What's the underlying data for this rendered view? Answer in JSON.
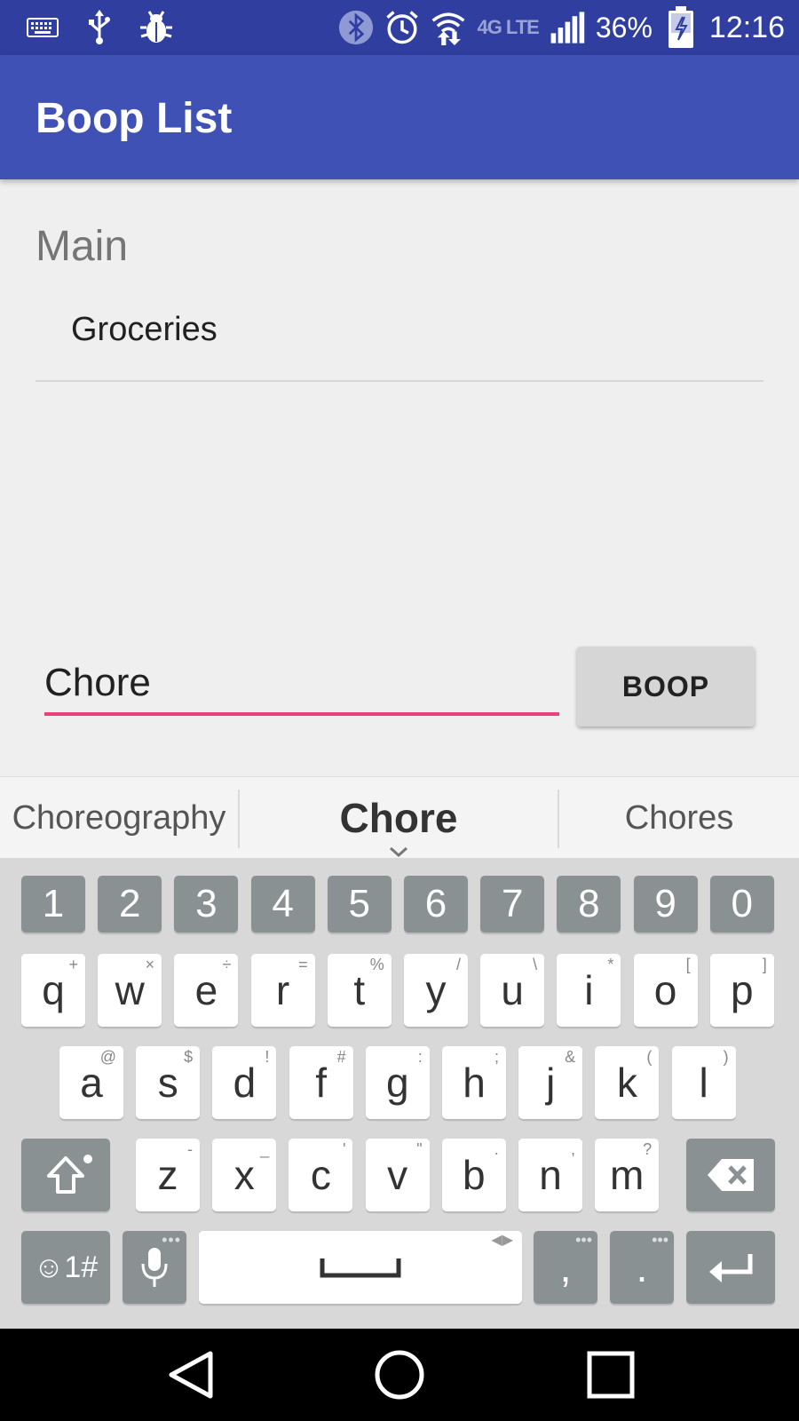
{
  "status_bar": {
    "battery_percent": "36%",
    "time": "12:16",
    "network_label": "4G LTE",
    "left_icons": [
      "keyboard-icon",
      "usb-icon",
      "bug-icon"
    ],
    "right_icons": [
      "bluetooth-icon",
      "alarm-icon",
      "wifi-icon",
      "signal-icon",
      "battery-charging-icon"
    ]
  },
  "app_bar": {
    "title": "Boop List"
  },
  "section": {
    "title": "Main",
    "items": [
      {
        "label": "Groceries"
      }
    ]
  },
  "input": {
    "value": "Chore"
  },
  "boop_button": {
    "label": "BOOP"
  },
  "suggestions": {
    "left": "Choreography",
    "center": "Chore",
    "right": "Chores"
  },
  "keyboard": {
    "numbers": [
      "1",
      "2",
      "3",
      "4",
      "5",
      "6",
      "7",
      "8",
      "9",
      "0"
    ],
    "row1": [
      {
        "k": "q",
        "alt": "+"
      },
      {
        "k": "w",
        "alt": "×"
      },
      {
        "k": "e",
        "alt": "÷"
      },
      {
        "k": "r",
        "alt": "="
      },
      {
        "k": "t",
        "alt": "%"
      },
      {
        "k": "y",
        "alt": "/"
      },
      {
        "k": "u",
        "alt": "\\"
      },
      {
        "k": "i",
        "alt": "*"
      },
      {
        "k": "o",
        "alt": "["
      },
      {
        "k": "p",
        "alt": "]"
      }
    ],
    "row2": [
      {
        "k": "a",
        "alt": "@"
      },
      {
        "k": "s",
        "alt": "$"
      },
      {
        "k": "d",
        "alt": "!"
      },
      {
        "k": "f",
        "alt": "#"
      },
      {
        "k": "g",
        "alt": ":"
      },
      {
        "k": "h",
        "alt": ";"
      },
      {
        "k": "j",
        "alt": "&"
      },
      {
        "k": "k",
        "alt": "("
      },
      {
        "k": "l",
        "alt": ")"
      }
    ],
    "row3": [
      {
        "k": "z",
        "alt": "-"
      },
      {
        "k": "x",
        "alt": "_"
      },
      {
        "k": "c",
        "alt": "'"
      },
      {
        "k": "v",
        "alt": "\""
      },
      {
        "k": "b",
        "alt": "."
      },
      {
        "k": "n",
        "alt": ","
      },
      {
        "k": "m",
        "alt": "?"
      }
    ],
    "symbols_label": "☺1#",
    "comma_label": ",",
    "period_label": ".",
    "icons": [
      "shift-icon",
      "backspace-icon",
      "mic-icon",
      "space-icon",
      "enter-icon"
    ]
  },
  "nav_bar": {
    "icons": [
      "back-icon",
      "home-icon",
      "recents-icon"
    ]
  },
  "colors": {
    "status_bar": "#303f9f",
    "app_bar": "#3f51b5",
    "accent": "#ec407a",
    "background": "#efefef"
  }
}
